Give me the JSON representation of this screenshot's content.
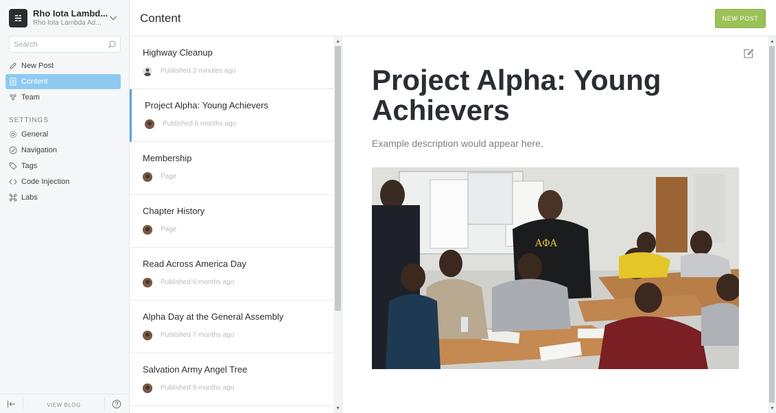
{
  "brand": {
    "title": "Rho Iota Lambd...",
    "subtitle": "Rho Iota Lambda Ad...",
    "logo_icon": "ghost-menu-icon"
  },
  "search": {
    "placeholder": "Search"
  },
  "nav": {
    "new_post": "New Post",
    "content": "Content",
    "team": "Team",
    "settings_heading": "SETTINGS",
    "general": "General",
    "navigation": "Navigation",
    "tags": "Tags",
    "code_injection": "Code Injection",
    "labs": "Labs"
  },
  "footer": {
    "view_blog": "VIEW BLOG"
  },
  "header": {
    "title": "Content",
    "new_post_button": "NEW POST"
  },
  "colors": {
    "accent": "#9bc159",
    "active_nav": "#8ecaf0",
    "active_post_border": "#5ba4e5"
  },
  "posts": [
    {
      "title": "Highway Cleanup",
      "meta": "Published 3 minutes ago",
      "avatar": "default"
    },
    {
      "title": "Project Alpha: Young Achievers",
      "meta": "Published 6 months ago",
      "avatar": "photo"
    },
    {
      "title": "Membership",
      "meta": "Page",
      "avatar": "photo"
    },
    {
      "title": "Chapter History",
      "meta": "Page",
      "avatar": "photo"
    },
    {
      "title": "Read Across America Day",
      "meta": "Published 6 months ago",
      "avatar": "photo"
    },
    {
      "title": "Alpha Day at the General Assembly",
      "meta": "Published 7 months ago",
      "avatar": "photo"
    },
    {
      "title": "Salvation Army Angel Tree",
      "meta": "Published 9 months ago",
      "avatar": "photo"
    }
  ],
  "preview": {
    "title": "Project Alpha: Young Achievers",
    "description": "Example description would appear here.",
    "image_alt": "classroom-photo"
  }
}
